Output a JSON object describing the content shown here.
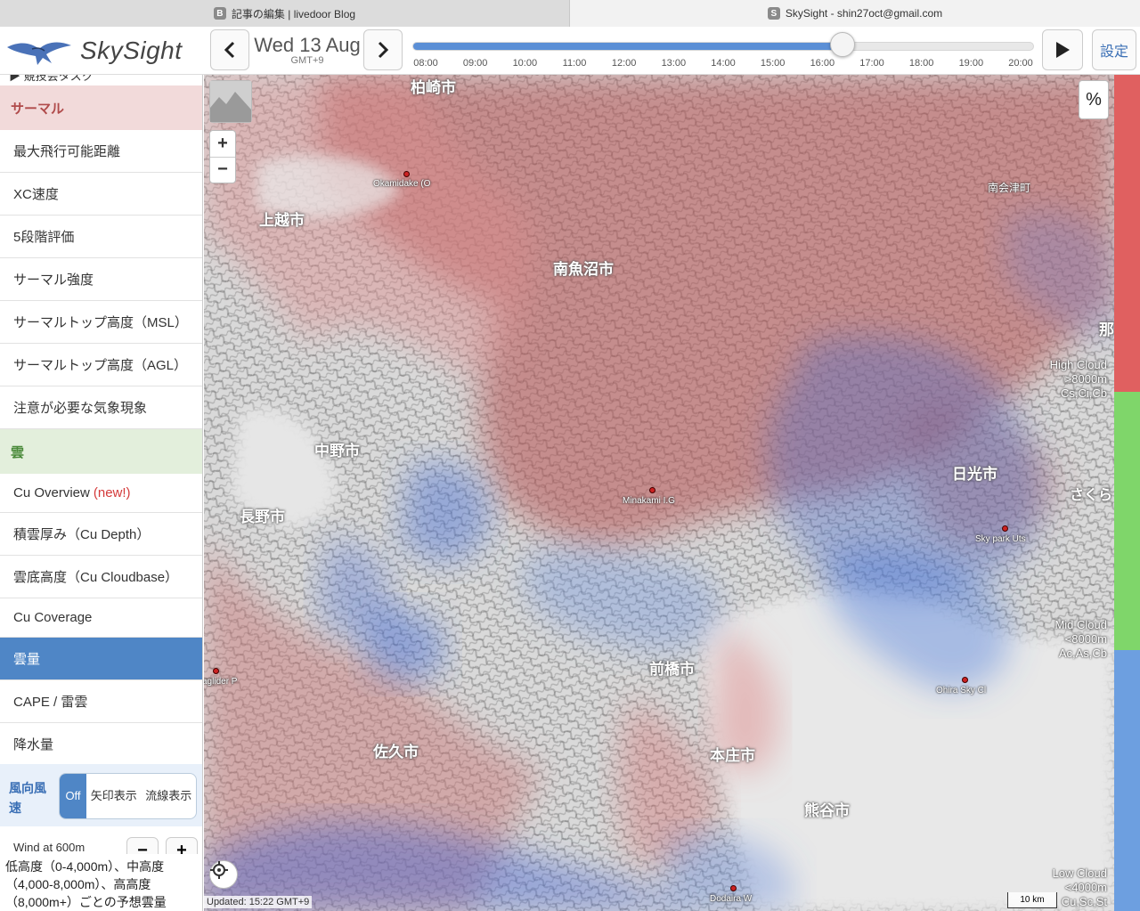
{
  "browser": {
    "tabs": [
      {
        "label": "記事の編集 | livedoor Blog",
        "favicon": "B"
      },
      {
        "label": "SkySight - shin27oct@gmail.com",
        "favicon": "S"
      }
    ]
  },
  "header": {
    "app_name": "SkySight",
    "date": "Wed 13 Aug",
    "timezone": "GMT+9",
    "time_ticks": [
      "08:00",
      "09:00",
      "10:00",
      "11:00",
      "12:00",
      "13:00",
      "14:00",
      "15:00",
      "16:00",
      "17:00",
      "18:00",
      "19:00",
      "20:00"
    ],
    "selected_time": "16:30",
    "slider_fraction": 0.7,
    "settings_label": "設定"
  },
  "sidebar": {
    "top_partial": "▶ 競技会タスク",
    "thermal_section": "サーマル",
    "thermal_items": [
      "最大飛行可能距離",
      "XC速度",
      "5段階評価",
      "サーマル強度",
      "サーマルトップ高度（MSL）",
      "サーマルトップ高度（AGL）",
      "注意が必要な気象現象"
    ],
    "cloud_section": "雲",
    "cloud_items": [
      {
        "label": "Cu Overview",
        "tag": "(new!)"
      },
      {
        "label": "積雲厚み（Cu Depth）"
      },
      {
        "label": "雲底高度（Cu Cloudbase）"
      },
      {
        "label": "Cu Coverage"
      },
      {
        "label": "雲量",
        "active": true
      },
      {
        "label": "CAPE / 雷雲"
      },
      {
        "label": "降水量"
      }
    ],
    "wind": {
      "label": "風向風速",
      "options": [
        "Off",
        "矢印表示",
        "流線表示"
      ],
      "selected": "Off",
      "level_label": "Wind at 600m"
    },
    "description": "低高度（0-4,000m）、中高度（4,000-8,000m）、高高度（8,000m+）ごとの予想雲量"
  },
  "map": {
    "cities": [
      "柏崎市",
      "上越市",
      "南魚沼市",
      "南会津町",
      "中野市",
      "長野市",
      "日光市",
      "さくら",
      "那",
      "前橋市",
      "佐久市",
      "本庄市",
      "熊谷市"
    ],
    "sites": [
      "Okamidake (O",
      "Minakami I.G",
      "Sky park Uts",
      "Ohira Sky Cl",
      "aglider P",
      "Dodaira W"
    ],
    "legend": {
      "high": [
        "High Cloud",
        ">8000m",
        "Cs,Ci,Cb"
      ],
      "mid": [
        "Mid Cloud",
        "<8000m",
        "Ac,As,Cb"
      ],
      "low": [
        "Low Cloud",
        "<4000m",
        "Cu,Sc,St"
      ]
    },
    "pct_label": "%",
    "updated": "Updated: 15:22 GMT+9",
    "scale": "10 km",
    "colors": {
      "high": "#e06060",
      "mid": "#7fd66a",
      "low": "#6d9fe0",
      "accent": "#4f86c6"
    }
  }
}
